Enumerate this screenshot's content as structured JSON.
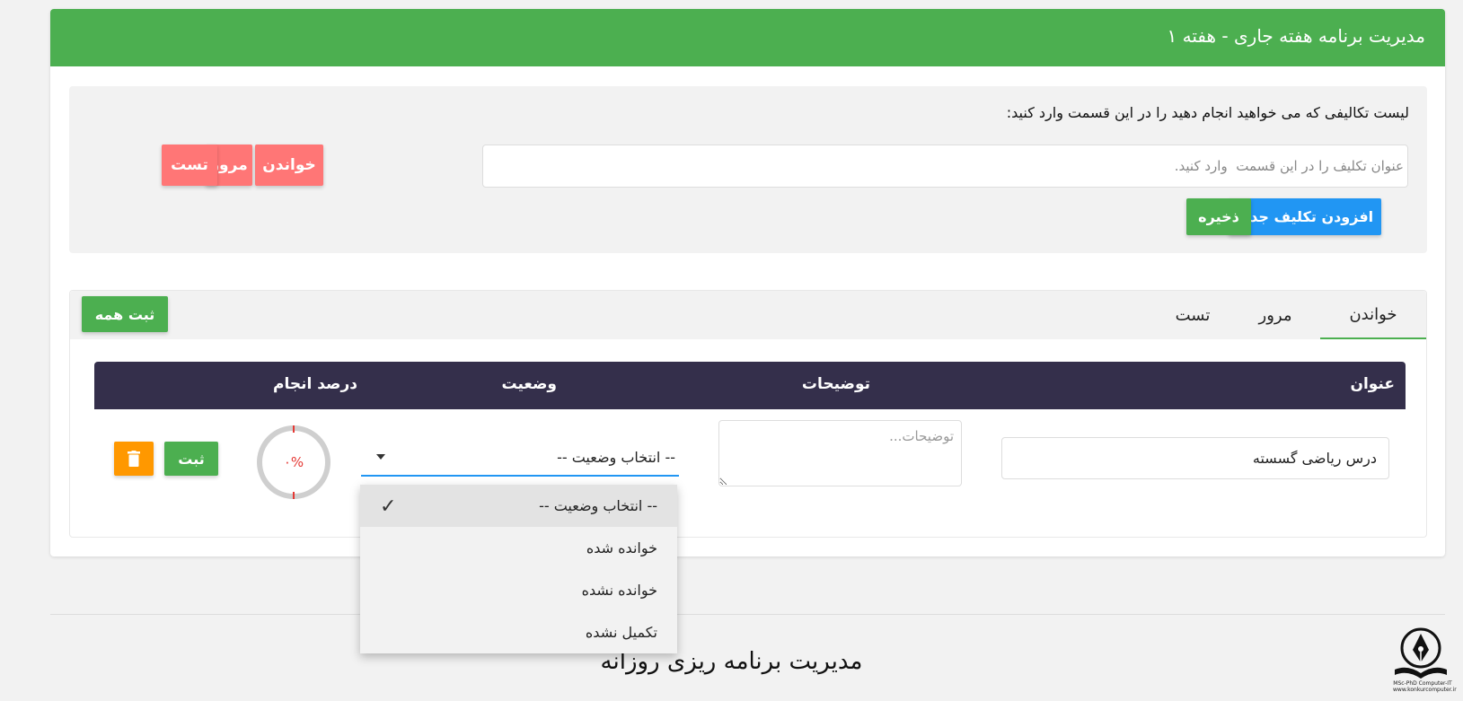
{
  "header": {
    "title": "مدیریت برنامه هفته جاری - هفته ۱"
  },
  "input_panel": {
    "label": "لیست تکالیفی که می خواهید انجام دهید را در این قسمت وارد کنید:",
    "task_input_placeholder": "عنوان تکلیف را در این قسمت  وارد کنید.",
    "add_button": "افزودن تکلیف جدید",
    "save_button": "ذخیره",
    "category_buttons": {
      "read": "خواندن",
      "review": "مرور",
      "test": "تست"
    }
  },
  "tabs": {
    "read": "خواندن",
    "review": "مرور",
    "test": "تست",
    "active": "خواندن"
  },
  "save_all_button": "ثبت همه",
  "table": {
    "headers": {
      "title": "عنوان",
      "description": "توضیحات",
      "status": "وضعیت",
      "percent": "درصد انجام"
    },
    "rows": [
      {
        "title": "درس ریاضی گسسته",
        "description_placeholder": "توضیحات...",
        "status": "-- انتخاب وضعیت --",
        "percent_text": "۰%",
        "percent_value": 0,
        "save_button": "ثبت"
      }
    ]
  },
  "status_dropdown": {
    "options": [
      "-- انتخاب وضعیت --",
      "خوانده شده",
      "خوانده نشده",
      "تکمیل نشده"
    ],
    "selected_index": 0
  },
  "footer": {
    "title": "مدیریت برنامه ریزی روزانه"
  },
  "logo": {
    "text_line1": "MSc-PhD Computer-IT",
    "text_line2": "www.konkurcomputer.ir"
  },
  "colors": {
    "header_green": "#4caf50",
    "add_blue": "#2196f3",
    "category_red": "#ff7676",
    "table_head": "#342f4b",
    "delete_orange": "#ff9800",
    "percent_red": "#e53935"
  },
  "icons": {
    "trash": "trash-icon",
    "check": "check-icon",
    "caret": "caret-down-icon",
    "logo": "pen-book-logo"
  }
}
